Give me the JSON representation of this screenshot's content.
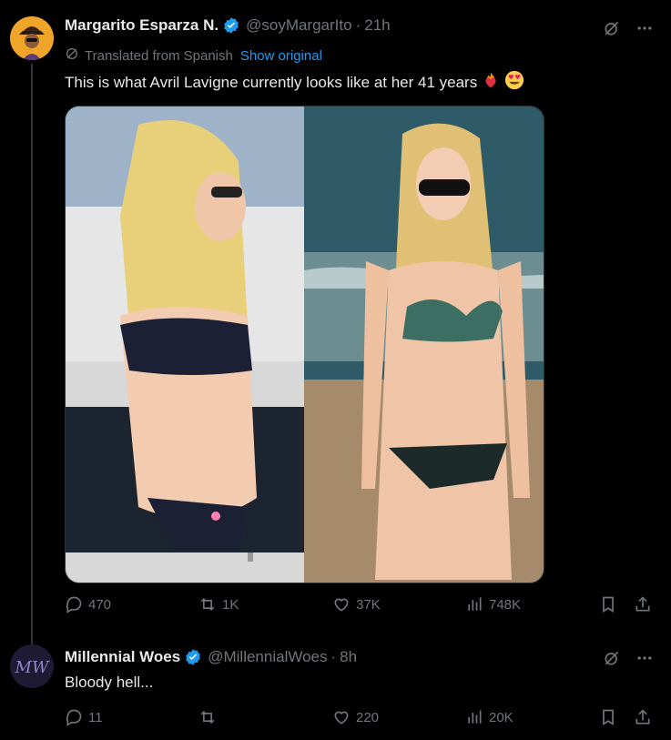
{
  "tweet1": {
    "display_name": "Margarito Esparza N.",
    "handle": "@soyMargarIto",
    "separator": "·",
    "time": "21h",
    "translated_label": "Translated from Spanish",
    "show_original": "Show original",
    "text": "This is what Avril Lavigne currently looks like at her 41 years",
    "emojis": [
      "heart-on-fire",
      "heart-eyes"
    ],
    "media_description_icons": [
      "photo-left-boat",
      "photo-right-beach"
    ],
    "stats": {
      "replies": "470",
      "reposts": "1K",
      "likes": "37K",
      "views": "748K"
    }
  },
  "tweet2": {
    "display_name": "Millennial Woes",
    "handle": "@MillennialWoes",
    "separator": "·",
    "time": "8h",
    "avatar_text": "MW",
    "text": "Bloody hell...",
    "stats": {
      "replies": "11",
      "reposts": "",
      "likes": "220",
      "views": "20K"
    }
  },
  "colors": {
    "background": "#000000",
    "primary_text": "#e7e9ea",
    "secondary_text": "#71767b",
    "link": "#1d9bf0",
    "verified": "#1d9bf0"
  }
}
